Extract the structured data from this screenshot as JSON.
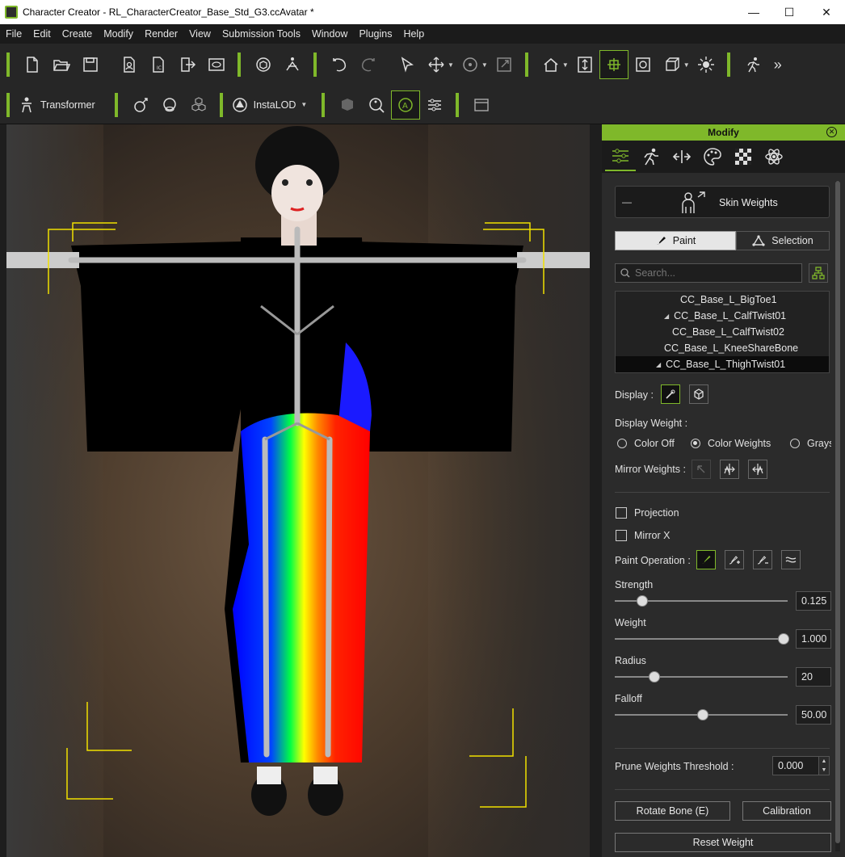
{
  "window": {
    "title": "Character Creator - RL_CharacterCreator_Base_Std_G3.ccAvatar *",
    "minimize": "—",
    "maximize": "☐",
    "close": "✕"
  },
  "menu": [
    "File",
    "Edit",
    "Create",
    "Modify",
    "Render",
    "View",
    "Submission Tools",
    "Window",
    "Plugins",
    "Help"
  ],
  "toolbar2": {
    "transformer_label": "Transformer",
    "instalod_label": "InstaLOD"
  },
  "panel": {
    "title": "Modify",
    "section": "Skin Weights",
    "collapse": "—",
    "modes": {
      "paint": "Paint",
      "selection": "Selection"
    },
    "search_placeholder": "Search...",
    "bones": [
      {
        "name": "CC_Base_L_BigToe1",
        "indent": 80,
        "expanded": false
      },
      {
        "name": "CC_Base_L_CalfTwist01",
        "indent": 60,
        "expanded": true
      },
      {
        "name": "CC_Base_L_CalfTwist02",
        "indent": 70,
        "expanded": false
      },
      {
        "name": "CC_Base_L_KneeShareBone",
        "indent": 60,
        "expanded": false
      },
      {
        "name": "CC_Base_L_ThighTwist01",
        "indent": 50,
        "expanded": true,
        "selected": true
      }
    ],
    "display_label": "Display :",
    "display_weight_label": "Display Weight :",
    "display_weight_options": [
      "Color Off",
      "Color Weights",
      "Grays"
    ],
    "display_weight_selected": "Color Weights",
    "mirror_weights_label": "Mirror Weights :",
    "projection_label": "Projection",
    "mirror_x_label": "Mirror X",
    "paint_operation_label": "Paint Operation :",
    "sliders": [
      {
        "name": "Strength",
        "value": "0.125",
        "fraction": 0.125
      },
      {
        "name": "Weight",
        "value": "1.000",
        "fraction": 1.0
      },
      {
        "name": "Radius",
        "value": "20",
        "fraction": 0.2
      },
      {
        "name": "Falloff",
        "value": "50.00",
        "fraction": 0.5
      }
    ],
    "prune_label": "Prune Weights Threshold :",
    "prune_value": "0.000",
    "rotate_bone_label": "Rotate Bone (E)",
    "calibration_label": "Calibration",
    "reset_weight_label": "Reset Weight"
  },
  "colors": {
    "accent": "#7fb82a",
    "panel_bg": "#2b2b2b",
    "toolbar_bg": "#262626"
  }
}
